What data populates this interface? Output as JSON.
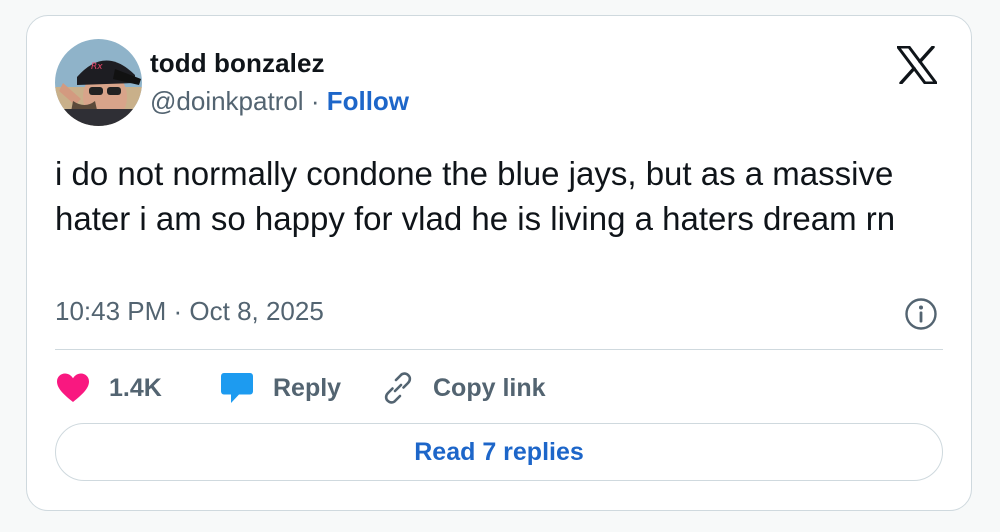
{
  "author": {
    "display_name": "todd bonzalez",
    "handle": "@doinkpatrol",
    "separator": " · ",
    "follow_label": "Follow"
  },
  "brand": {
    "logo_icon": "x-logo-icon"
  },
  "tweet": {
    "text": "i do not normally condone the blue jays, but as a massive hater i am so happy for vlad he is living a haters dream rn",
    "timestamp": "10:43 PM · Oct 8, 2025"
  },
  "actions": {
    "like_count": "1.4K",
    "reply_label": "Reply",
    "copy_link_label": "Copy link",
    "read_replies_label": "Read 7 replies"
  },
  "colors": {
    "text_primary": "#0f1419",
    "text_secondary": "#536471",
    "link_blue": "#1d66c9",
    "like_pink": "#f91880",
    "reply_blue": "#1d9bf0",
    "border": "#cfd9de"
  }
}
